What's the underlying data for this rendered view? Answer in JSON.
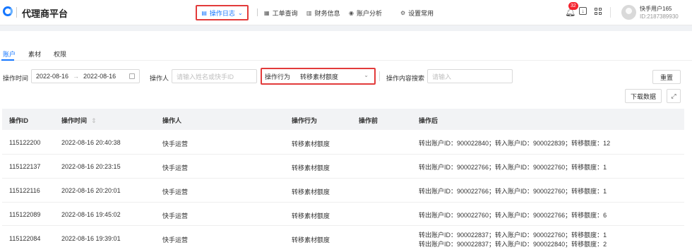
{
  "app": {
    "title": "代理商平台"
  },
  "nav": {
    "active": "操作日志",
    "items": [
      "工单查询",
      "财务信息",
      "账户分析",
      "设置常用"
    ]
  },
  "header": {
    "notification_count": "32",
    "user_name": "快手用户165",
    "user_id": "ID:2187389930"
  },
  "tabs": [
    "账户",
    "素材",
    "权限"
  ],
  "filters": {
    "time_label": "操作时间",
    "date_start": "2022-08-16",
    "date_end": "2022-08-16",
    "operator_label": "操作人",
    "operator_placeholder": "请输入姓名或快手ID",
    "action_label": "操作行为",
    "action_value": "转移素材额度",
    "content_label": "操作内容搜索",
    "content_placeholder": "请输入",
    "reset_label": "重置",
    "download_label": "下载数据"
  },
  "table": {
    "columns": [
      "操作ID",
      "操作时间",
      "操作人",
      "操作行为",
      "操作前",
      "操作后"
    ],
    "rows": [
      {
        "id": "115122200",
        "time": "2022-08-16 20:40:38",
        "operator": "快手运营",
        "action": "转移素材额度",
        "before": "",
        "after": [
          "转出账户ID：900022840；转入账户ID：900022839；转移额度：12"
        ]
      },
      {
        "id": "115122137",
        "time": "2022-08-16 20:23:15",
        "operator": "快手运营",
        "action": "转移素材额度",
        "before": "",
        "after": [
          "转出账户ID：900022766；转入账户ID：900022760；转移额度：1"
        ]
      },
      {
        "id": "115122116",
        "time": "2022-08-16 20:20:01",
        "operator": "快手运营",
        "action": "转移素材额度",
        "before": "",
        "after": [
          "转出账户ID：900022766；转入账户ID：900022760；转移额度：1"
        ]
      },
      {
        "id": "115122089",
        "time": "2022-08-16 19:45:02",
        "operator": "快手运营",
        "action": "转移素材额度",
        "before": "",
        "after": [
          "转出账户ID：900022760；转入账户ID：900022766；转移额度：6"
        ]
      },
      {
        "id": "115122084",
        "time": "2022-08-16 19:39:01",
        "operator": "快手运营",
        "action": "转移素材额度",
        "before": "",
        "after": [
          "转出账户ID：900022837；转入账户ID：900022760；转移额度：1",
          "转出账户ID：900022837；转入账户ID：900022840；转移额度：2"
        ]
      }
    ]
  }
}
